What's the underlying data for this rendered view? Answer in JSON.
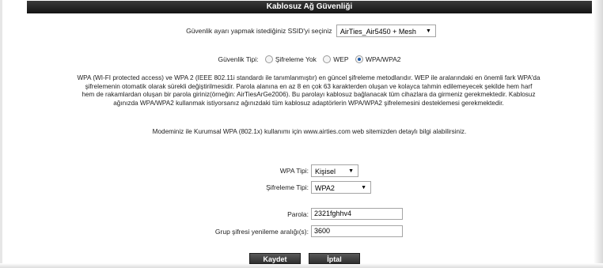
{
  "header": {
    "title": "Kablosuz Ağ Güvenliği"
  },
  "ssid": {
    "label": "Güvenlik ayarı yapmak istediğiniz SSID'yi seçiniz",
    "selected": "AirTies_Air5450 + Mesh"
  },
  "security_type": {
    "label": "Güvenlik Tipi:",
    "options": [
      "Şifreleme Yok",
      "WEP",
      "WPA/WPA2"
    ],
    "selected": "WPA/WPA2"
  },
  "description": {
    "lines": [
      "WPA (WI-FI protected access) ve WPA 2 (IEEE 802.11i standardı ile tanımlanmıştır) en güncel şifreleme metodlarıdır. WEP ile aralarındaki en önemli fark WPA'da",
      "şifrelemenin otomatik olarak sürekli değiştirilmesidir. Parola alanına en az 8 en çok 63 karakterden oluşan ve kolayca tahmin edilemeyecek şekilde hem harf",
      "hem de rakamlardan oluşan bir parola giriniz(örneğin: AirTiesArGe2006). Bu parolayı kablosuz bağlanacak tüm cihazlara da girmeniz gerekmektedir. Kablosuz",
      "ağınızda WPA/WPA2 kullanmak istiyorsanız ağınızdaki tüm kablosuz adaptörlerin WPA/WPA2 şifrelemesini desteklemesi gerekmektedir."
    ],
    "enterprise_note": "Modeminiz ile Kurumsal WPA (802.1x) kullanımı için www.airties.com web sitemizden detaylı bilgi alabilirsiniz."
  },
  "wpa_type": {
    "label": "WPA Tipi:",
    "selected": "Kişisel"
  },
  "encryption_type": {
    "label": "Şifreleme Tipi:",
    "selected": "WPA2"
  },
  "password": {
    "label": "Parola:",
    "value": "2321fghhv4"
  },
  "group_key": {
    "label": "Grup şifresi yenileme aralığı(s):",
    "value": "3600"
  },
  "buttons": {
    "save": "Kaydet",
    "cancel": "İptal"
  }
}
